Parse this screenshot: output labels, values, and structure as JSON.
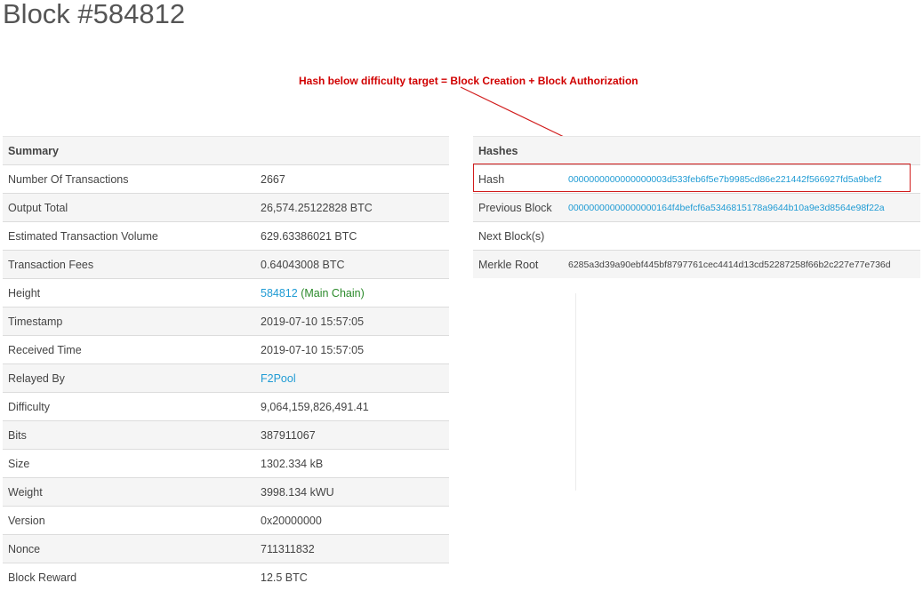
{
  "page": {
    "title": "Block #584812"
  },
  "annotation": {
    "text": "Hash below difficulty target = Block Creation + Block Authorization",
    "color": "#d00000"
  },
  "summary": {
    "heading": "Summary",
    "rows": {
      "num_tx": {
        "label": "Number Of Transactions",
        "value": "2667"
      },
      "output_total": {
        "label": "Output Total",
        "value": "26,574.25122828 BTC"
      },
      "est_volume": {
        "label": "Estimated Transaction Volume",
        "value": "629.63386021 BTC"
      },
      "fees": {
        "label": "Transaction Fees",
        "value": "0.64043008 BTC"
      },
      "height": {
        "label": "Height",
        "value": "584812",
        "extra": "(Main Chain)"
      },
      "timestamp": {
        "label": "Timestamp",
        "value": "2019-07-10 15:57:05"
      },
      "received": {
        "label": "Received Time",
        "value": "2019-07-10 15:57:05"
      },
      "relayed": {
        "label": "Relayed By",
        "value": "F2Pool"
      },
      "difficulty": {
        "label": "Difficulty",
        "value": "9,064,159,826,491.41"
      },
      "bits": {
        "label": "Bits",
        "value": "387911067"
      },
      "size": {
        "label": "Size",
        "value": "1302.334 kB"
      },
      "weight": {
        "label": "Weight",
        "value": "3998.134 kWU"
      },
      "version": {
        "label": "Version",
        "value": "0x20000000"
      },
      "nonce": {
        "label": "Nonce",
        "value": "711311832"
      },
      "reward": {
        "label": "Block Reward",
        "value": "12.5 BTC"
      }
    }
  },
  "hashes": {
    "heading": "Hashes",
    "rows": {
      "hash": {
        "label": "Hash",
        "value": "0000000000000000003d533feb6f5e7b9985cd86e221442f566927fd5a9bef2"
      },
      "prev": {
        "label": "Previous Block",
        "value": "00000000000000000164f4befcf6a5346815178a9644b10a9e3d8564e98f22a"
      },
      "next": {
        "label": "Next Block(s)",
        "value": ""
      },
      "merkle": {
        "label": "Merkle Root",
        "value": "6285a3d39a90ebf445bf8797761cec4414d13cd52287258f66b2c227e77e736d"
      }
    }
  },
  "colors": {
    "link": "#1f9bd4",
    "main_chain": "#2a8a2a",
    "highlight": "#d11c1c"
  }
}
